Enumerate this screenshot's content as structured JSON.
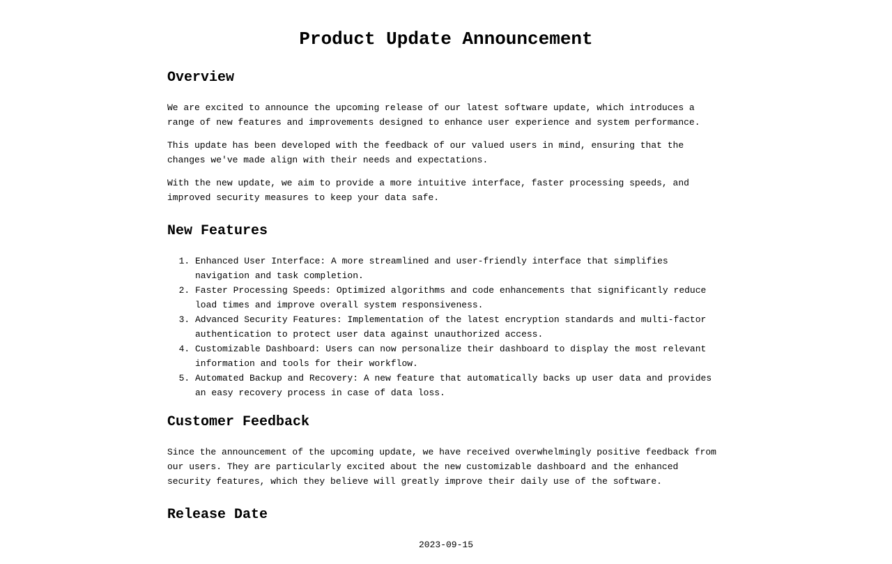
{
  "title": "Product Update Announcement",
  "overview": {
    "heading": "Overview",
    "paragraphs": [
      "We are excited to announce the upcoming release of our latest software update, which introduces a range of new features and improvements designed to enhance user experience and system performance.",
      "This update has been developed with the feedback of our valued users in mind, ensuring that the changes we've made align with their needs and expectations.",
      "With the new update, we aim to provide a more intuitive interface, faster processing speeds, and improved security measures to keep your data safe."
    ]
  },
  "features": {
    "heading": "New Features",
    "items": [
      "Enhanced User Interface: A more streamlined and user-friendly interface that simplifies navigation and task completion.",
      "Faster Processing Speeds: Optimized algorithms and code enhancements that significantly reduce load times and improve overall system responsiveness.",
      "Advanced Security Features: Implementation of the latest encryption standards and multi-factor authentication to protect user data against unauthorized access.",
      "Customizable Dashboard: Users can now personalize their dashboard to display the most relevant information and tools for their workflow.",
      "Automated Backup and Recovery: A new feature that automatically backs up user data and provides an easy recovery process in case of data loss."
    ]
  },
  "feedback": {
    "heading": "Customer Feedback",
    "paragraph": "Since the announcement of the upcoming update, we have received overwhelmingly positive feedback from our users. They are particularly excited about the new customizable dashboard and the enhanced security features, which they believe will greatly improve their daily use of the software."
  },
  "release": {
    "heading": "Release Date",
    "date": "2023-09-15"
  }
}
